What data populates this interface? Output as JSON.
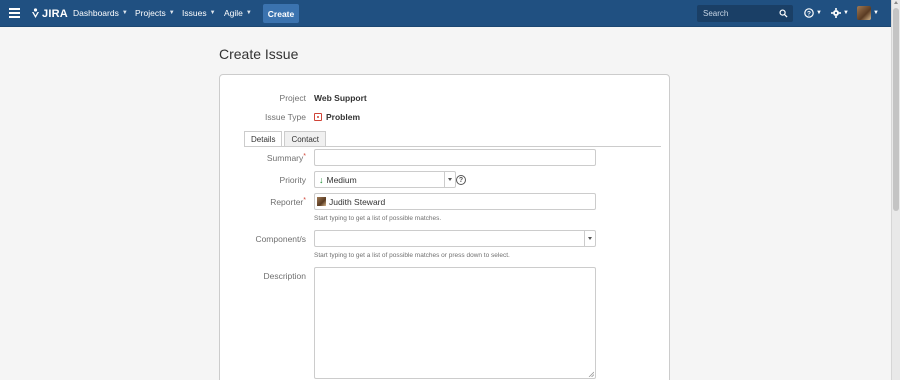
{
  "header": {
    "logo_text": "JIRA",
    "nav": [
      {
        "label": "Dashboards"
      },
      {
        "label": "Projects"
      },
      {
        "label": "Issues"
      },
      {
        "label": "Agile"
      }
    ],
    "create_label": "Create",
    "search_placeholder": "Search"
  },
  "page": {
    "title": "Create Issue"
  },
  "form": {
    "project_label": "Project",
    "project_value": "Web Support",
    "issue_type_label": "Issue Type",
    "issue_type_value": "Problem",
    "tabs": [
      {
        "label": "Details",
        "active": true
      },
      {
        "label": "Contact",
        "active": false
      }
    ],
    "summary_label": "Summary",
    "summary_value": "",
    "priority_label": "Priority",
    "priority_value": "Medium",
    "reporter_label": "Reporter",
    "reporter_value": "Judith Steward",
    "reporter_hint": "Start typing to get a list of possible matches.",
    "components_label": "Component/s",
    "components_value": "",
    "components_hint": "Start typing to get a list of possible matches or press down to select.",
    "description_label": "Description",
    "description_value": ""
  },
  "colors": {
    "header_bg": "#205081",
    "create_btn": "#3b73af",
    "required": "#d04437",
    "priority_medium": "#14892c"
  }
}
